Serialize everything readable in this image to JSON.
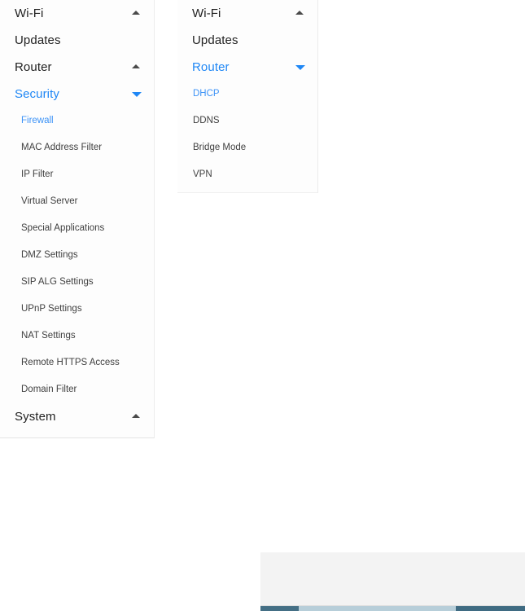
{
  "left_panel": {
    "name": "primary-navigation-menu",
    "rows": [
      {
        "label": "Wi-Fi",
        "state": "collapsible",
        "caret": "caret-up-icon",
        "active": false
      },
      {
        "label": "Updates",
        "state": "plain",
        "caret": null,
        "active": false
      },
      {
        "label": "Router",
        "state": "collapsible",
        "caret": "caret-up-icon",
        "active": false
      },
      {
        "label": "Security",
        "state": "expanded",
        "caret": "caret-down-icon",
        "active": true
      }
    ],
    "security_submenu": [
      {
        "label": "Firewall",
        "active": true
      },
      {
        "label": "MAC Address Filter",
        "active": false
      },
      {
        "label": "IP Filter",
        "active": false
      },
      {
        "label": "Virtual Server",
        "active": false
      },
      {
        "label": "Special Applications",
        "active": false
      },
      {
        "label": "DMZ Settings",
        "active": false
      },
      {
        "label": "SIP ALG Settings",
        "active": false
      },
      {
        "label": "UPnP Settings",
        "active": false
      },
      {
        "label": "NAT Settings",
        "active": false
      },
      {
        "label": "Remote HTTPS Access",
        "active": false
      },
      {
        "label": "Domain Filter",
        "active": false
      }
    ],
    "footer_row": {
      "label": "System",
      "caret": "caret-up-icon",
      "active": false
    }
  },
  "right_panel": {
    "name": "secondary-navigation-menu",
    "rows": [
      {
        "label": "Wi-Fi",
        "state": "collapsible",
        "caret": "caret-up-icon",
        "active": false
      },
      {
        "label": "Updates",
        "state": "plain",
        "caret": null,
        "active": false
      },
      {
        "label": "Router",
        "state": "expanded",
        "caret": "caret-down-icon",
        "active": true
      }
    ],
    "router_submenu": [
      {
        "label": "DHCP",
        "active": true
      },
      {
        "label": "DDNS",
        "active": false
      },
      {
        "label": "Bridge Mode",
        "active": false
      },
      {
        "label": "VPN",
        "active": false
      }
    ]
  },
  "content_panel": {
    "name": "content-area",
    "background_color": "#f3f3f3",
    "scrollbar": {
      "track_color": "#b7ced9",
      "thumb_color": "#446f85"
    }
  },
  "colors": {
    "accent": "#1f87f5",
    "sub_accent": "#3d93f7",
    "text": "#222222",
    "sub_text": "#404040",
    "panel_bg": "#fdfdfd",
    "page_bg": "#ffffff"
  }
}
